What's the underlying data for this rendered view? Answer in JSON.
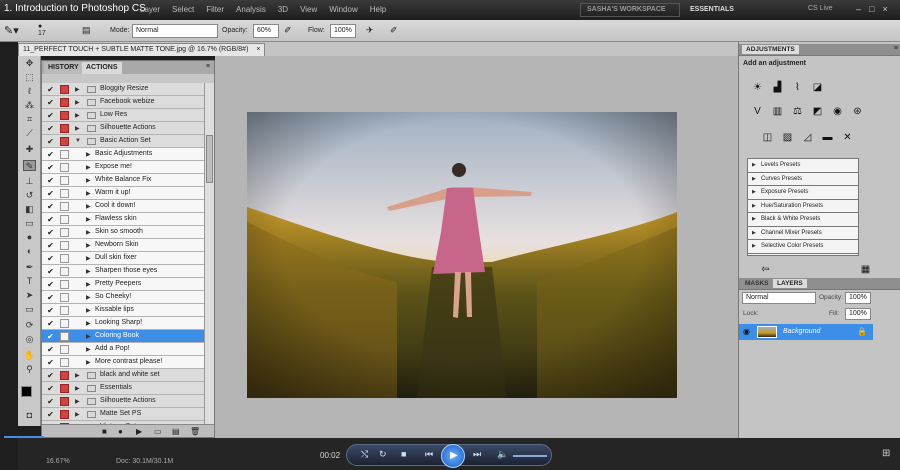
{
  "window": {
    "video_title": "1. Introduction to Photoshop CS",
    "menus": [
      "Layer",
      "Select",
      "Filter",
      "Analysis",
      "3D",
      "View",
      "Window",
      "Help"
    ],
    "workspace": "SASHA'S WORKSPACE",
    "essentials": "ESSENTIALS",
    "cs_live": "CS Live"
  },
  "options": {
    "brush_size": "17",
    "mode_label": "Mode:",
    "mode_value": "Normal",
    "opacity_label": "Opacity:",
    "opacity_value": "60%",
    "flow_label": "Flow:",
    "flow_value": "100%"
  },
  "document": {
    "tab_title": "11_PERFECT TOUCH + SUBTLE MATTE TONE.jpg @ 16.7% (RGB/8#)",
    "tab_close": "×"
  },
  "actions_panel": {
    "tabs": [
      "HISTORY",
      "ACTIONS"
    ],
    "rows": [
      {
        "type": "set",
        "label": "Bloggity Resize"
      },
      {
        "type": "set",
        "label": "Facebook webize"
      },
      {
        "type": "set",
        "label": "Low Res"
      },
      {
        "type": "set",
        "label": "Silhouette Actions"
      },
      {
        "type": "open",
        "label": "Basic Action Set"
      },
      {
        "type": "action",
        "label": "Basic Adjustments"
      },
      {
        "type": "action",
        "label": "Expose me!"
      },
      {
        "type": "action",
        "label": "White Balance Fix"
      },
      {
        "type": "action",
        "label": "Warm it up!"
      },
      {
        "type": "action",
        "label": "Cool it down!"
      },
      {
        "type": "action",
        "label": "Flawless skin"
      },
      {
        "type": "action",
        "label": "Skin so smooth"
      },
      {
        "type": "action",
        "label": "Newborn Skin"
      },
      {
        "type": "action",
        "label": "Dull skin fixer"
      },
      {
        "type": "action",
        "label": "Sharpen those eyes"
      },
      {
        "type": "action",
        "label": "Pretty Peepers"
      },
      {
        "type": "action",
        "label": "So Cheeky!"
      },
      {
        "type": "action",
        "label": "Kissable lips"
      },
      {
        "type": "action",
        "label": "Looking Sharp!"
      },
      {
        "type": "selected",
        "label": "Coloring Book"
      },
      {
        "type": "action",
        "label": "Add a Pop!"
      },
      {
        "type": "action",
        "label": "More contrast please!"
      },
      {
        "type": "set",
        "label": "black and white set"
      },
      {
        "type": "set",
        "label": "Essentials"
      },
      {
        "type": "set",
        "label": "Silhouette Actions"
      },
      {
        "type": "set",
        "label": "Matte Set PS"
      },
      {
        "type": "set",
        "label": "Vintage Set"
      }
    ]
  },
  "adjustments": {
    "tab": "ADJUSTMENTS",
    "heading": "Add an adjustment",
    "presets": [
      "Levels Presets",
      "Curves Presets",
      "Exposure Presets",
      "Hue/Saturation Presets",
      "Black & White Presets",
      "Channel Mixer Presets",
      "Selective Color Presets"
    ]
  },
  "layers": {
    "tabs": [
      "MASKS",
      "LAYERS"
    ],
    "blend_mode": "Normal",
    "opacity_label": "Opacity:",
    "opacity_value": "100%",
    "lock_label": "Lock:",
    "fill_label": "Fill:",
    "fill_value": "100%",
    "layer_name": "Background"
  },
  "status": {
    "zoom": "16.67%",
    "doc": "Doc: 30.1M/30.1M"
  },
  "video": {
    "time": "00:02"
  },
  "colors": {
    "selection": "#3d8ee6",
    "canvas_bg": "#b5b5b5"
  }
}
